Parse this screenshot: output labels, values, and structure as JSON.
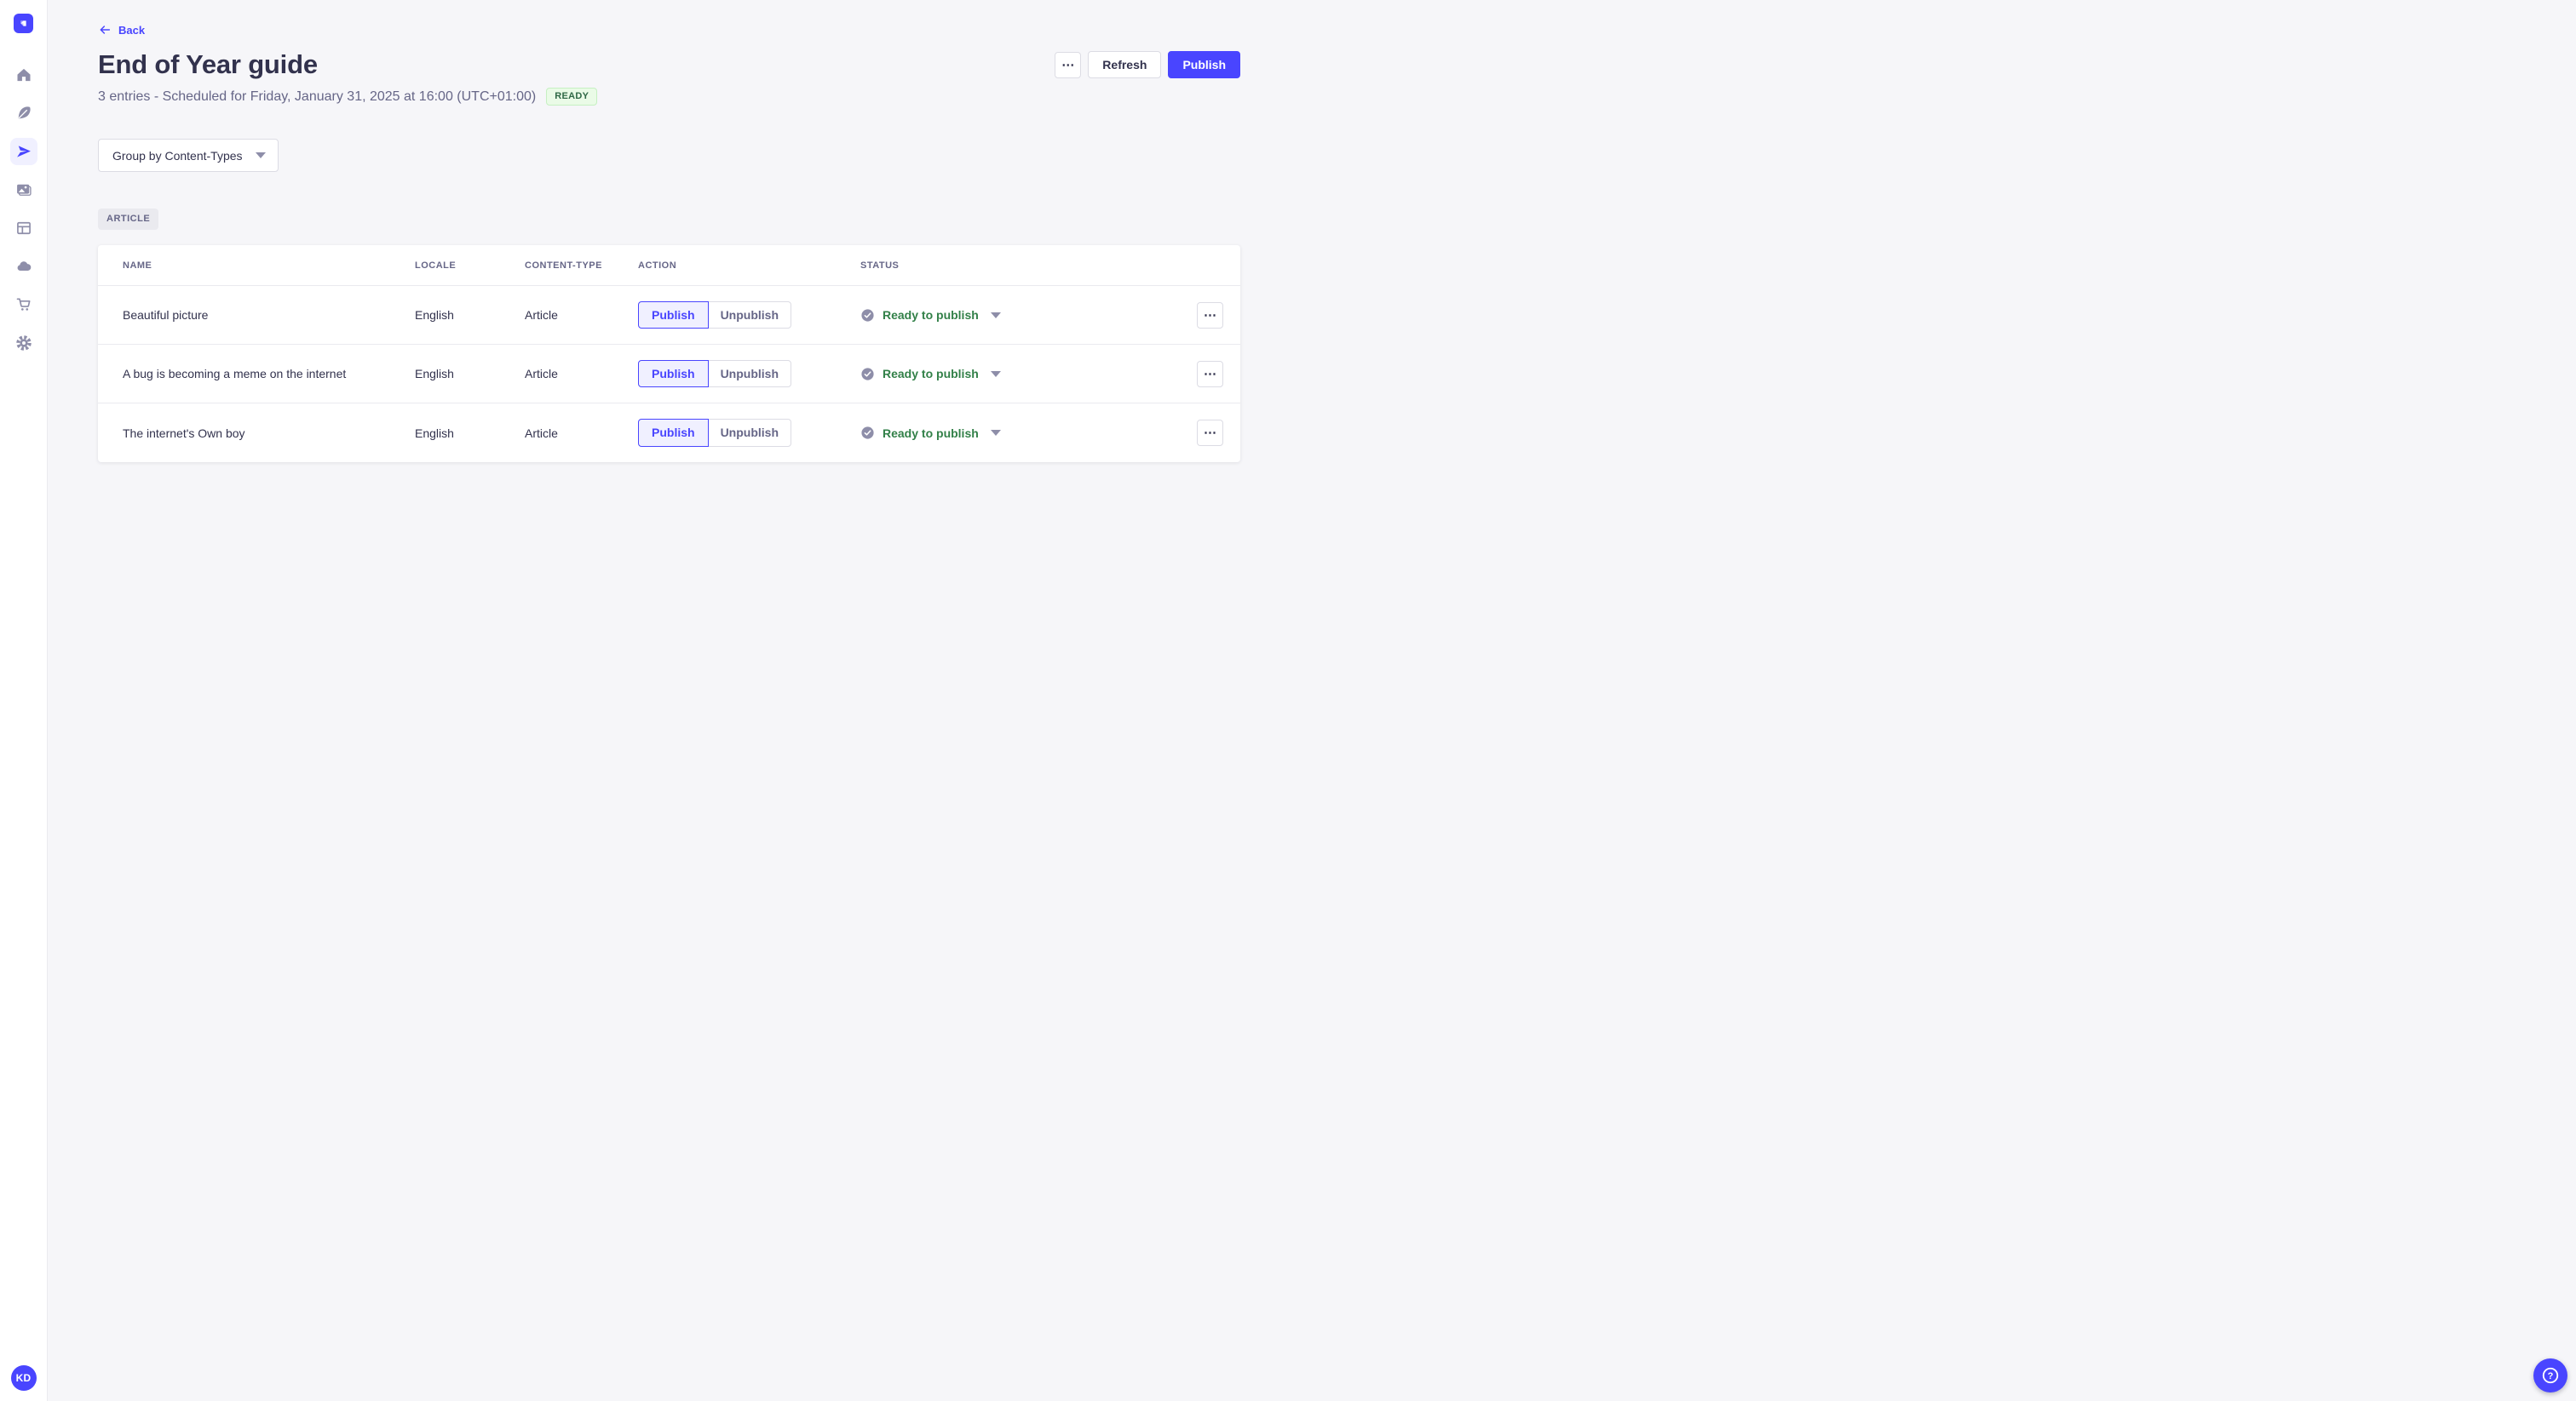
{
  "colors": {
    "accent": "#4945ff",
    "accent_light_bg": "#f0f0ff",
    "success_badge_bg": "#eafbe7",
    "success_badge_border": "#c6f0c2",
    "success_badge_text": "#2f6846",
    "status_text": "#328048",
    "neutral_icon": "#8e8ea9",
    "text_dark": "#32324d",
    "text_muted": "#666687",
    "page_bg": "#f6f6f9"
  },
  "sidebar": {
    "logo_icon": "strapi-logo",
    "nav_icons": [
      "home-icon",
      "content-manager-icon",
      "releases-icon",
      "media-library-icon",
      "content-type-builder-icon",
      "cloud-icon",
      "marketplace-icon",
      "settings-icon"
    ],
    "active_item": "releases",
    "avatar_initials": "KD"
  },
  "header": {
    "back_label": "Back",
    "title": "End of Year guide",
    "subtitle": "3 entries - Scheduled for Friday, January 31, 2025 at 16:00 (UTC+01:00)",
    "release_status": "READY",
    "more_glyph": "⋯",
    "refresh_label": "Refresh",
    "publish_label": "Publish"
  },
  "toolbar": {
    "group_by_value": "Group by Content-Types"
  },
  "group_section": {
    "label": "ARTICLE"
  },
  "table": {
    "headers": [
      "NAME",
      "LOCALE",
      "CONTENT-TYPE",
      "ACTION",
      "STATUS"
    ],
    "action_publish_label": "Publish",
    "action_unpublish_label": "Unpublish",
    "row_more_glyph": "⋯",
    "rows": [
      {
        "name": "Beautiful picture",
        "locale": "English",
        "content_type": "Article",
        "status": "Ready to publish"
      },
      {
        "name": "A bug is becoming a meme on the internet",
        "locale": "English",
        "content_type": "Article",
        "status": "Ready to publish"
      },
      {
        "name": "The internet's Own boy",
        "locale": "English",
        "content_type": "Article",
        "status": "Ready to publish"
      }
    ]
  },
  "footer": {
    "help_glyph": "?"
  }
}
